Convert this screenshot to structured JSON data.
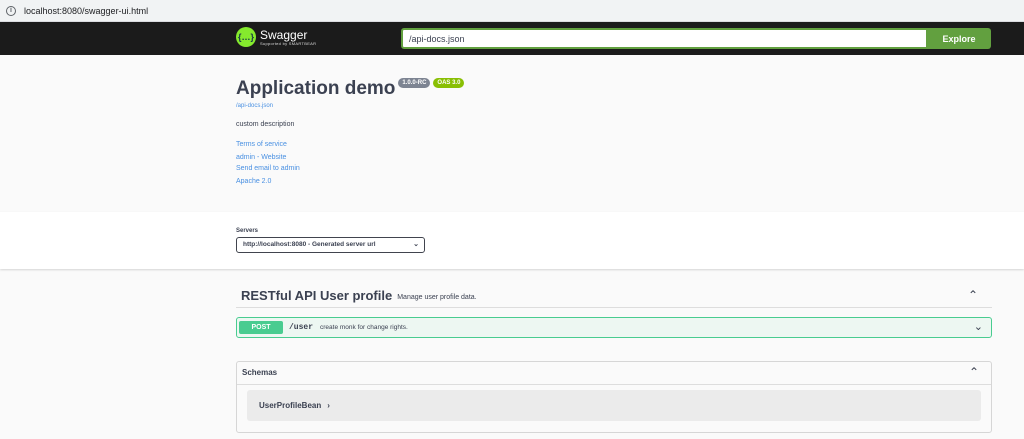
{
  "browser": {
    "url": "localhost:8080/swagger-ui.html",
    "info_icon": "info-icon"
  },
  "topbar": {
    "logo_glyph": "{…}",
    "logo_title": "Swagger",
    "logo_sub": "Supported by SMARTBEAR",
    "url_value": "/api-docs.json",
    "explore_label": "Explore"
  },
  "info": {
    "title": "Application demo",
    "version": "1.0.0-RC",
    "oas": "OAS 3.0",
    "spec_link": "/api-docs.json",
    "description": "custom description",
    "terms": "Terms of service",
    "contact_website": "admin - Website",
    "contact_email": "Send email to admin",
    "license": "Apache 2.0"
  },
  "servers": {
    "label": "Servers",
    "selected": "http://localhost:8080 - Generated server url"
  },
  "tag": {
    "name": "RESTful API User profile",
    "description": "Manage user profile data.",
    "collapse_icon": "chevron-up-icon"
  },
  "operations": [
    {
      "method": "POST",
      "path": "/user",
      "summary": "create monk for change rights.",
      "expand_icon": "chevron-down-icon"
    }
  ],
  "schemas": {
    "title": "Schemas",
    "collapse_icon": "chevron-up-icon",
    "models": [
      {
        "name": "UserProfileBean",
        "arrow": "›"
      }
    ]
  },
  "colors": {
    "topbar": "#1b1b1b",
    "accent": "#62a03f",
    "post": "#49cc90",
    "link": "#4990e2",
    "version_badge": "#7d8492",
    "oas_badge": "#89bf04"
  }
}
